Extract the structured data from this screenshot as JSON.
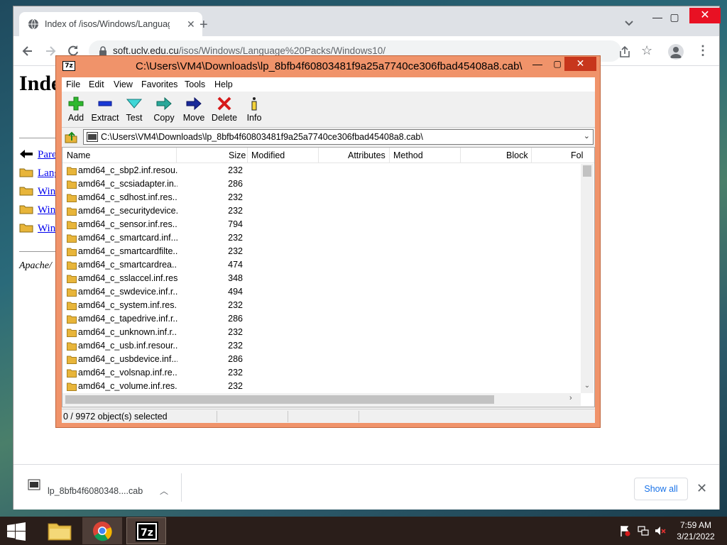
{
  "browser": {
    "tab_title": "Index of /isos/Windows/Languag",
    "url_host": "soft.uclv.edu.cu",
    "url_path": "/isos/Windows/Language%20Packs/Windows10/"
  },
  "page": {
    "heading": "Inde",
    "links": [
      "Pare",
      "Lang",
      "Win",
      "Win",
      "Win"
    ],
    "footer": "Apache/"
  },
  "download_bar": {
    "file_name": "lp_8bfb4f6080348....cab",
    "show_all": "Show all"
  },
  "sevenzip": {
    "title": "C:\\Users\\VM4\\Downloads\\lp_8bfb4f60803481f9a25a7740ce306fbad45408a8.cab\\",
    "menu": [
      "File",
      "Edit",
      "View",
      "Favorites",
      "Tools",
      "Help"
    ],
    "toolbar": {
      "add": "Add",
      "extract": "Extract",
      "test": "Test",
      "copy": "Copy",
      "move": "Move",
      "delete": "Delete",
      "info": "Info"
    },
    "path": "C:\\Users\\VM4\\Downloads\\lp_8bfb4f60803481f9a25a7740ce306fbad45408a8.cab\\",
    "columns": {
      "name": "Name",
      "size": "Size",
      "modified": "Modified",
      "attributes": "Attributes",
      "method": "Method",
      "block": "Block",
      "folders": "Fol"
    },
    "rows": [
      {
        "name": "amd64_c_sbp2.inf.resou...",
        "size": "232"
      },
      {
        "name": "amd64_c_scsiadapter.in...",
        "size": "286"
      },
      {
        "name": "amd64_c_sdhost.inf.res...",
        "size": "232"
      },
      {
        "name": "amd64_c_securitydevice...",
        "size": "232"
      },
      {
        "name": "amd64_c_sensor.inf.res...",
        "size": "794"
      },
      {
        "name": "amd64_c_smartcard.inf....",
        "size": "232"
      },
      {
        "name": "amd64_c_smartcardfilte...",
        "size": "232"
      },
      {
        "name": "amd64_c_smartcardrea...",
        "size": "474"
      },
      {
        "name": "amd64_c_sslaccel.inf.res...",
        "size": "348"
      },
      {
        "name": "amd64_c_swdevice.inf.r...",
        "size": "494"
      },
      {
        "name": "amd64_c_system.inf.res...",
        "size": "232"
      },
      {
        "name": "amd64_c_tapedrive.inf.r...",
        "size": "286"
      },
      {
        "name": "amd64_c_unknown.inf.r...",
        "size": "232"
      },
      {
        "name": "amd64_c_usb.inf.resour...",
        "size": "232"
      },
      {
        "name": "amd64_c_usbdevice.inf....",
        "size": "286"
      },
      {
        "name": "amd64_c_volsnap.inf.re...",
        "size": "232"
      },
      {
        "name": "amd64_c_volume.inf.res...",
        "size": "232"
      }
    ],
    "status": "0 / 9972 object(s) selected"
  },
  "taskbar": {
    "time": "7:59 AM",
    "date": "3/21/2022"
  },
  "colors": {
    "sevenzip_frame": "#f0936a",
    "close_red": "#e81123",
    "link_blue": "#0000ee",
    "folder_yellow": "#e8b53a"
  }
}
